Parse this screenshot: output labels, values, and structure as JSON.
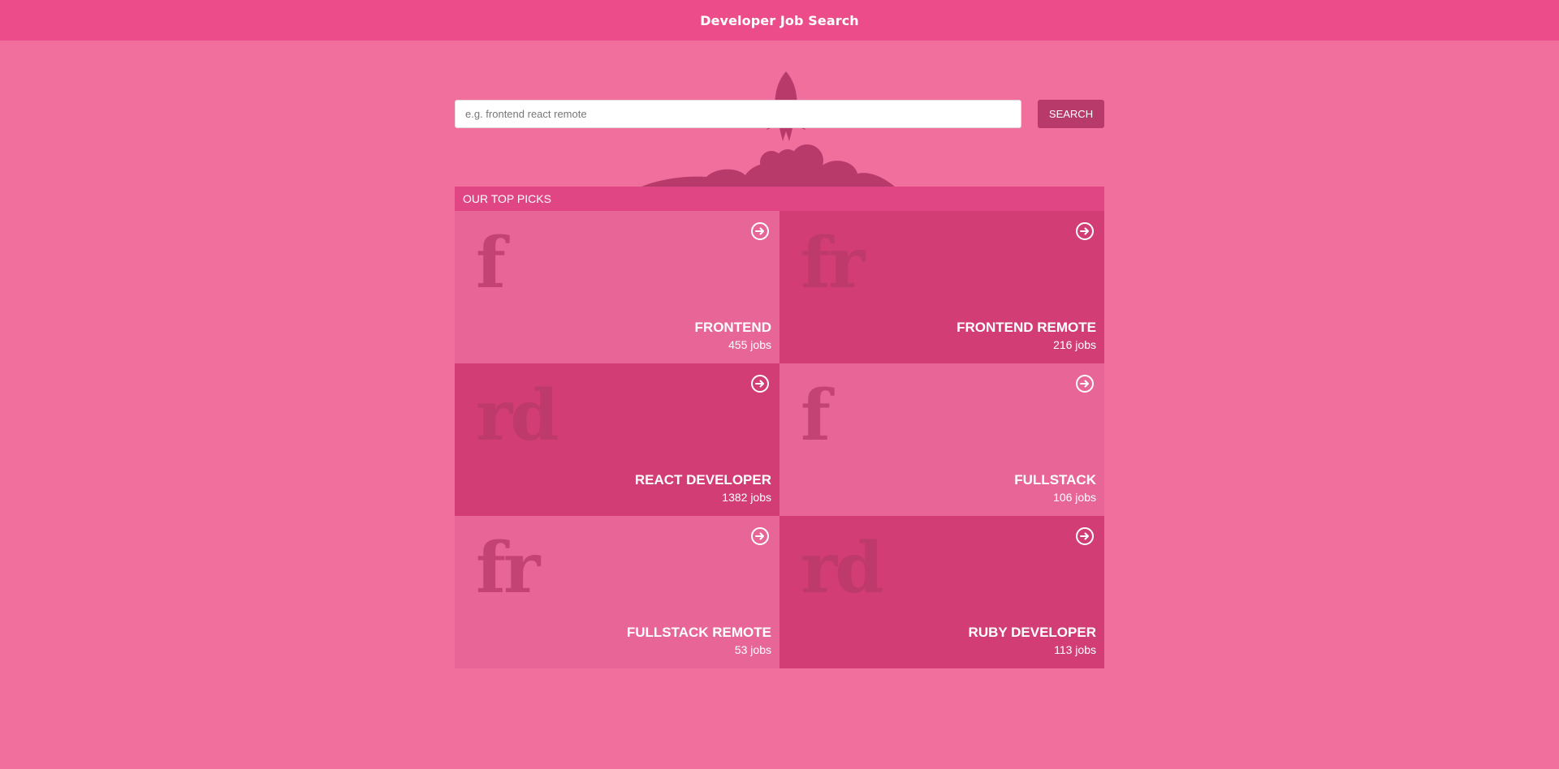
{
  "app": {
    "title": "Developer Job Search"
  },
  "search": {
    "placeholder": "e.g. frontend react remote",
    "value": "",
    "button_label": "SEARCH"
  },
  "picks": {
    "heading": "OUR TOP PICKS",
    "items": [
      {
        "abbr": "f",
        "title": "FRONTEND",
        "count": "455 jobs",
        "tone": "light"
      },
      {
        "abbr": "fr",
        "title": "FRONTEND REMOTE",
        "count": "216 jobs",
        "tone": "dark"
      },
      {
        "abbr": "rd",
        "title": "REACT DEVELOPER",
        "count": "1382 jobs",
        "tone": "dark"
      },
      {
        "abbr": "f",
        "title": "FULLSTACK",
        "count": "106 jobs",
        "tone": "light"
      },
      {
        "abbr": "fr",
        "title": "FULLSTACK REMOTE",
        "count": "53 jobs",
        "tone": "light"
      },
      {
        "abbr": "rd",
        "title": "RUBY DEVELOPER",
        "count": "113 jobs",
        "tone": "dark"
      }
    ]
  },
  "icons": {
    "card_link": "arrow-circle-right-icon",
    "hero_art": "rocket-launch-illustration"
  },
  "colors": {
    "page_background": "#f06f9d",
    "topbar": "#ec4d8a",
    "accent": "#b83a6b",
    "card_light": "#e76597",
    "card_dark": "#d13d74"
  }
}
